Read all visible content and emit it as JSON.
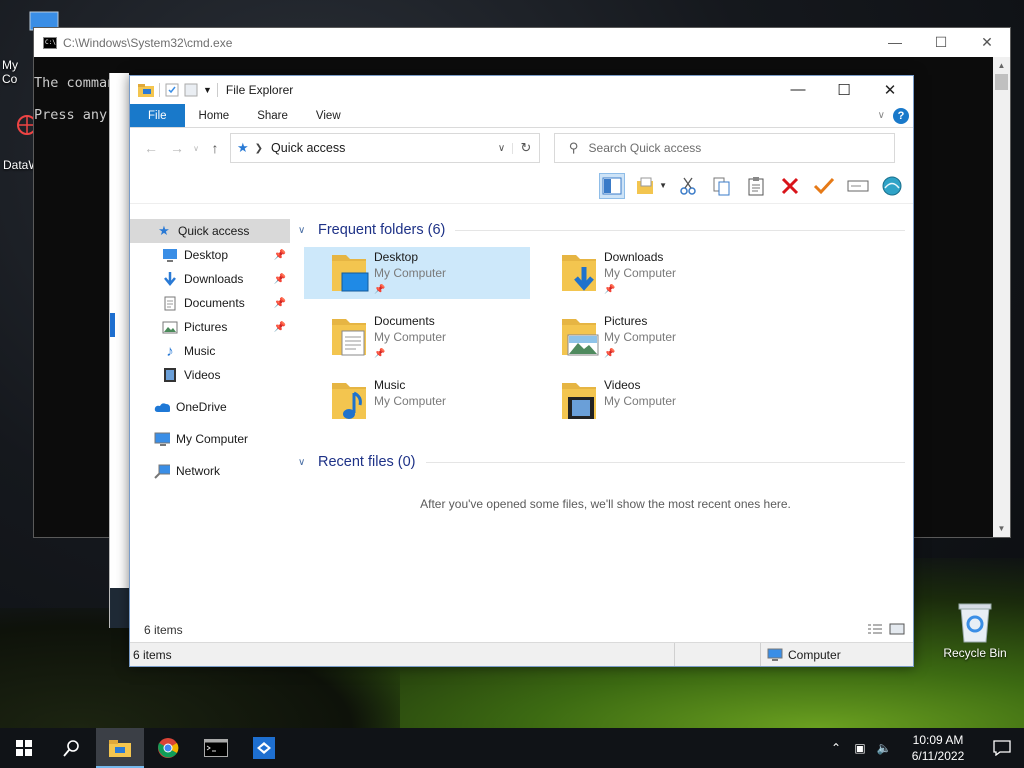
{
  "desktop": {
    "icons": [
      {
        "label": "My Co"
      },
      {
        "label": "DataW"
      },
      {
        "label": "Recycle Bin"
      }
    ]
  },
  "cmd": {
    "title": "C:\\Windows\\System32\\cmd.exe",
    "lines": [
      "The comman",
      "Press any"
    ]
  },
  "explorer": {
    "title": "File Explorer",
    "ribbon": {
      "tabs": [
        "File",
        "Home",
        "Share",
        "View"
      ]
    },
    "address": {
      "location": "Quick access"
    },
    "search": {
      "placeholder": "Search Quick access"
    },
    "nav_pane": [
      {
        "label": "Quick access"
      },
      {
        "label": "Desktop"
      },
      {
        "label": "Downloads"
      },
      {
        "label": "Documents"
      },
      {
        "label": "Pictures"
      },
      {
        "label": "Music"
      },
      {
        "label": "Videos"
      },
      {
        "label": "OneDrive"
      },
      {
        "label": "My Computer"
      },
      {
        "label": "Network"
      }
    ],
    "frequent": {
      "header": "Frequent folders (6)",
      "items": [
        {
          "name": "Desktop",
          "location": "My Computer"
        },
        {
          "name": "Downloads",
          "location": "My Computer"
        },
        {
          "name": "Documents",
          "location": "My Computer"
        },
        {
          "name": "Pictures",
          "location": "My Computer"
        },
        {
          "name": "Music",
          "location": "My Computer"
        },
        {
          "name": "Videos",
          "location": "My Computer"
        }
      ]
    },
    "recent": {
      "header": "Recent files (0)",
      "empty_text": "After you've opened some files, we'll show the most recent ones here."
    },
    "status": {
      "count": "6 items",
      "count2": "6 items",
      "computer": "Computer"
    }
  },
  "taskbar": {
    "time": "10:09 AM",
    "date": "6/11/2022"
  },
  "colors": {
    "accent": "#1979ca",
    "folder": "#f3c54f",
    "selection": "#cde8fa"
  }
}
